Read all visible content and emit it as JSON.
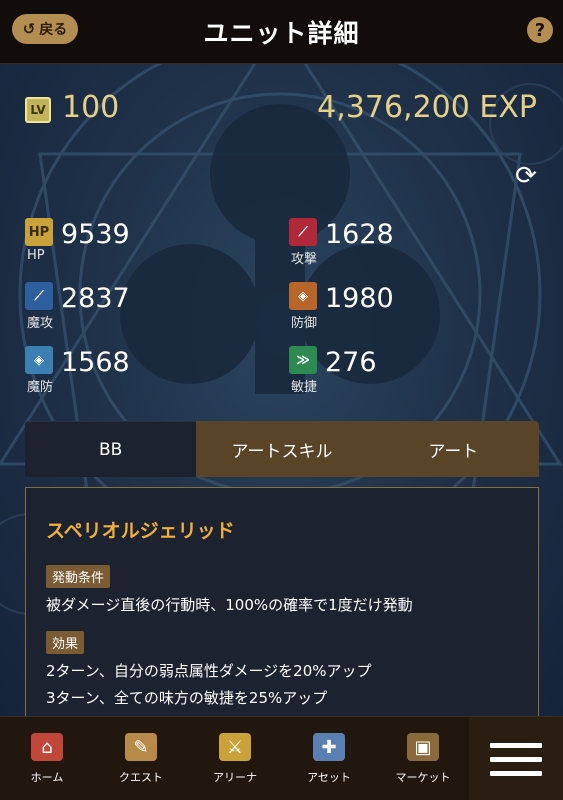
{
  "header": {
    "back_label": "戻る",
    "title": "ユニット詳細",
    "help_label": "?"
  },
  "level": {
    "badge": "LV",
    "value": "100",
    "exp": "4,376,200 EXP"
  },
  "stats": [
    {
      "icon": "hp-icon",
      "icon_text": "HP",
      "label": "HP",
      "value": "9539",
      "color": "#c9a23a"
    },
    {
      "icon": "attack-icon",
      "icon_text": "",
      "label": "攻撃",
      "value": "1628",
      "color": "#b0283a"
    },
    {
      "icon": "magic-attack-icon",
      "icon_text": "",
      "label": "魔攻",
      "value": "2837",
      "color": "#2d5e9e"
    },
    {
      "icon": "defense-icon",
      "icon_text": "",
      "label": "防御",
      "value": "1980",
      "color": "#b8652a"
    },
    {
      "icon": "magic-defense-icon",
      "icon_text": "",
      "label": "魔防",
      "value": "1568",
      "color": "#3b7fb3"
    },
    {
      "icon": "agility-icon",
      "icon_text": "",
      "label": "敏捷",
      "value": "276",
      "color": "#2f8a52"
    }
  ],
  "tabs": [
    {
      "label": "BB",
      "active": true
    },
    {
      "label": "アートスキル",
      "active": false
    },
    {
      "label": "アート",
      "active": false
    }
  ],
  "skill": {
    "name": "スペリオルジェリッド",
    "condition_label": "発動条件",
    "condition_text": "被ダメージ直後の行動時、100%の確率で1度だけ発動",
    "effect_label": "効果",
    "effects": [
      "2ターン、自分の弱点属性ダメージを20%アップ",
      "3ターン、全ての味方の敏捷を25%アップ"
    ]
  },
  "nav": [
    {
      "label": "ホーム",
      "icon": "home-icon",
      "color": "#c0473a"
    },
    {
      "label": "クエスト",
      "icon": "quest-scroll-icon",
      "color": "#b88a4a"
    },
    {
      "label": "アリーナ",
      "icon": "crossed-swords-icon",
      "color": "#c9a23a"
    },
    {
      "label": "アセット",
      "icon": "asset-icon",
      "color": "#5a7fb3"
    },
    {
      "label": "マーケット",
      "icon": "market-chest-icon",
      "color": "#8a6a3a"
    }
  ]
}
